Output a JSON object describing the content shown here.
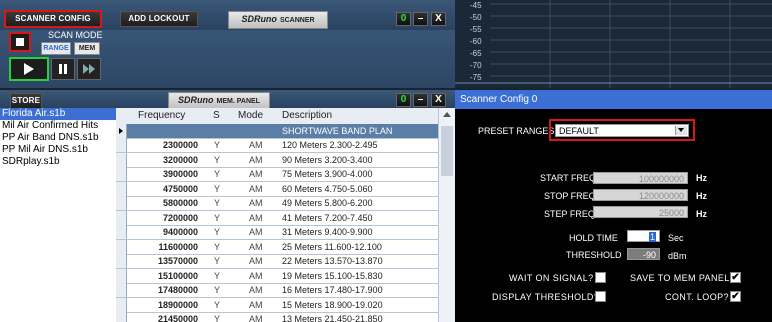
{
  "scanner": {
    "scanner_config_label": "SCANNER CONFIG",
    "add_lockout_label": "ADD LOCKOUT",
    "brand": "SDRuno",
    "brand_sub": "SCANNER",
    "scan_mode_label": "SCAN MODE",
    "range_label": "RANGE",
    "mem_label": "MEM"
  },
  "window_buttons": {
    "panel": "0",
    "minimize": "–",
    "close": "X"
  },
  "spectrum": {
    "db_labels": [
      "-45",
      "-50",
      "-55",
      "-60",
      "-65",
      "-70",
      "-75"
    ]
  },
  "mem_panel": {
    "store_label": "STORE",
    "brand": "SDRuno",
    "brand_sub": "MEM. PANEL",
    "files": [
      "Florida Air.s1b",
      "Mil Air Confirmed Hits",
      "PP Air Band DNS.s1b",
      "PP Mil Air DNS.s1b",
      "SDRplay.s1b"
    ],
    "selected_file": "Florida Air.s1b",
    "columns": {
      "frequency": "Frequency",
      "s": "S",
      "mode": "Mode",
      "description": "Description"
    },
    "band_row": "SHORTWAVE BAND PLAN",
    "rows": [
      {
        "f": "2300000",
        "s": "Y",
        "m": "AM",
        "d": "120 Meters 2.300-2.495"
      },
      {
        "f": "3200000",
        "s": "Y",
        "m": "AM",
        "d": "90 Meters 3.200-3.400"
      },
      {
        "f": "3900000",
        "s": "Y",
        "m": "AM",
        "d": "75 Meters 3.900-4.000"
      },
      {
        "f": "4750000",
        "s": "Y",
        "m": "AM",
        "d": "60 Meters 4.750-5.060"
      },
      {
        "f": "5800000",
        "s": "Y",
        "m": "AM",
        "d": "49 Meters 5.800-6.200"
      },
      {
        "f": "7200000",
        "s": "Y",
        "m": "AM",
        "d": "41 Meters 7.200-7.450"
      },
      {
        "f": "9400000",
        "s": "Y",
        "m": "AM",
        "d": "31 Meters 9.400-9.900"
      },
      {
        "f": "11600000",
        "s": "Y",
        "m": "AM",
        "d": "25 Meters 11.600-12.100"
      },
      {
        "f": "13570000",
        "s": "Y",
        "m": "AM",
        "d": "22 Meters 13.570-13.870"
      },
      {
        "f": "15100000",
        "s": "Y",
        "m": "AM",
        "d": "19 Meters 15.100-15.830"
      },
      {
        "f": "17480000",
        "s": "Y",
        "m": "AM",
        "d": "16 Meters 17.480-17.900"
      },
      {
        "f": "18900000",
        "s": "Y",
        "m": "AM",
        "d": "15 Meters 18.900-19.020"
      },
      {
        "f": "21450000",
        "s": "Y",
        "m": "AM",
        "d": "13 Meters 21.450-21.850"
      }
    ]
  },
  "config": {
    "title": "Scanner Config 0",
    "preset_label": "PRESET RANGES:",
    "preset_value": "DEFAULT",
    "start_freq_label": "START FREQ",
    "start_freq_value": "100000000",
    "stop_freq_label": "STOP FREQ",
    "stop_freq_value": "120000000",
    "step_freq_label": "STEP FREQ",
    "step_freq_value": "25000",
    "hz": "Hz",
    "hold_time_label": "HOLD TIME",
    "hold_time_value": "1",
    "sec": "Sec",
    "threshold_label": "THRESHOLD",
    "threshold_value": "-90",
    "dbm": "dBm",
    "wait_on_signal_label": "WAIT ON SIGNAL?",
    "save_to_mem_label": "SAVE TO MEM PANEL?",
    "display_threshold_label": "DISPLAY THRESHOLD?",
    "cont_loop_label": "CONT. LOOP?",
    "wait_on_signal_checked": false,
    "save_to_mem_checked": true,
    "display_threshold_checked": false,
    "cont_loop_checked": true
  },
  "colors": {
    "accent": "#3b6fd3",
    "highlight_red": "#d81818",
    "band_row": "#5a7ea6",
    "play_green": "#23d13a"
  }
}
